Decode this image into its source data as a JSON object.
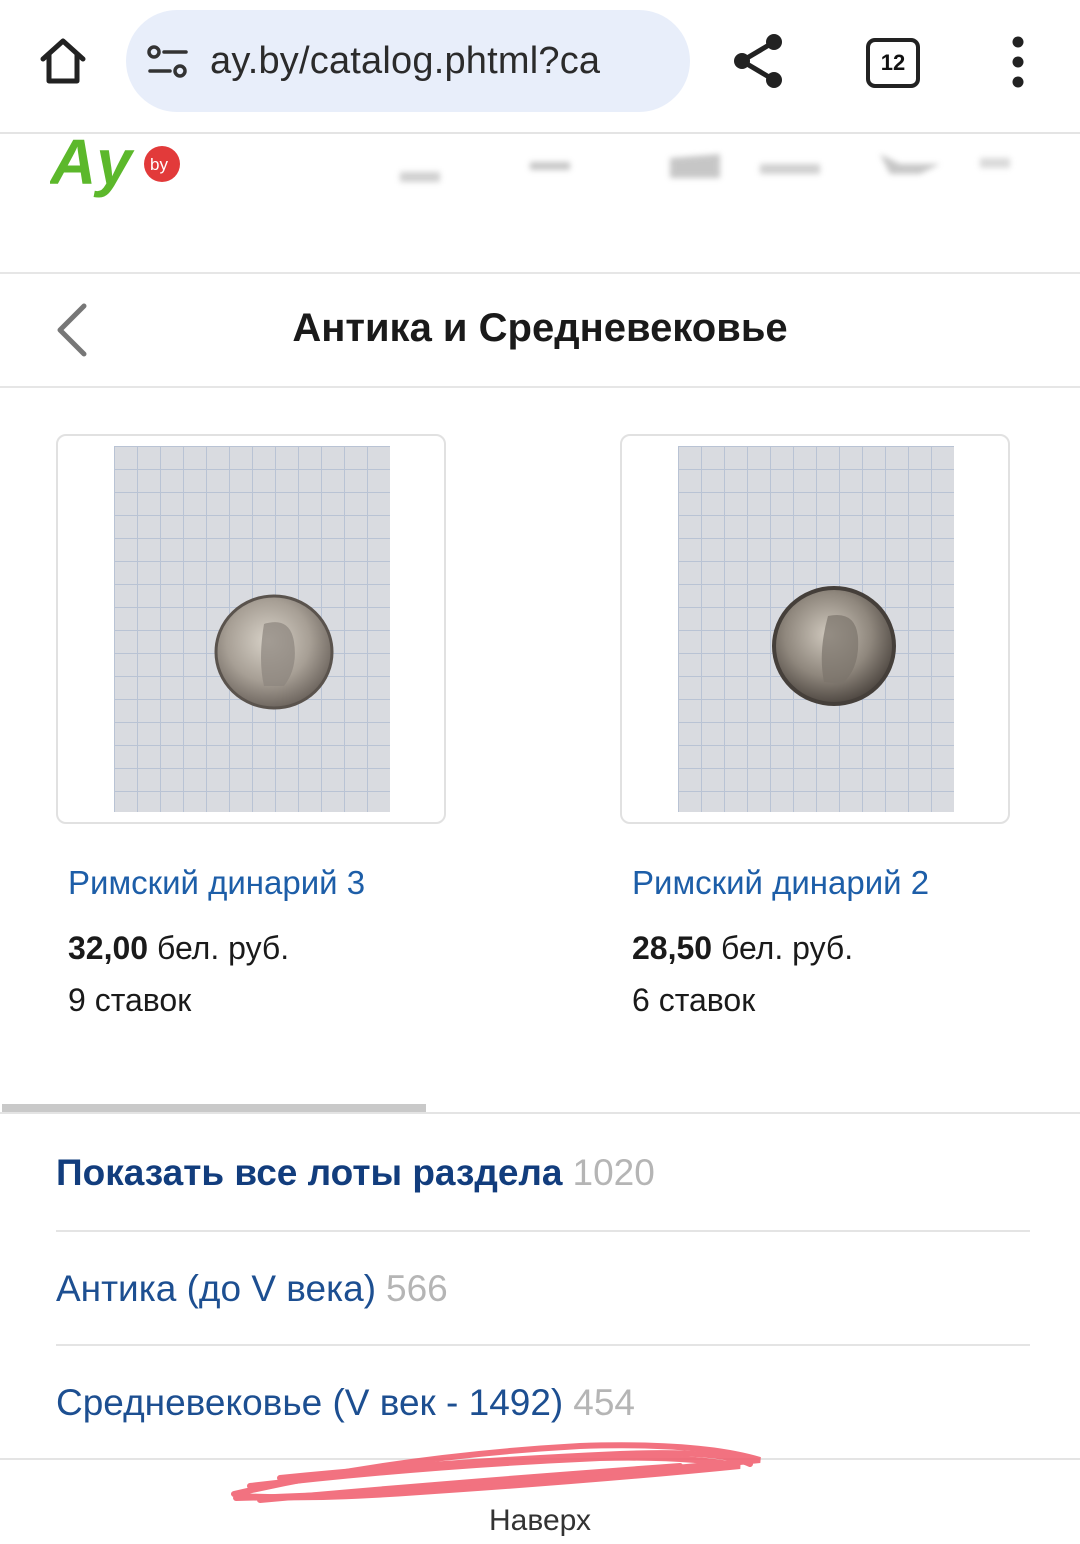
{
  "browser": {
    "url": "ay.by/catalog.phtml?ca",
    "tab_count": "12"
  },
  "site": {
    "logo_text": "Ay",
    "logo_badge": "by"
  },
  "page": {
    "title": "Антика и Средневековье"
  },
  "products": [
    {
      "name": "Римский динарий 3",
      "price_value": "32,00",
      "price_currency": "бел. руб.",
      "bids": "9 ставок"
    },
    {
      "name": "Римский динарий 2",
      "price_value": "28,50",
      "price_currency": "бел. руб.",
      "bids": "6 ставок"
    }
  ],
  "categories": [
    {
      "label": "Показать все лоты раздела",
      "count": "1020"
    },
    {
      "label": "Антика (до V века)",
      "count": "566"
    },
    {
      "label": "Средневековье (V век - 1492)",
      "count": "454"
    }
  ],
  "footer": {
    "to_top": "Наверх"
  },
  "colors": {
    "link_blue": "#1d5ea8",
    "logo_green": "#5cb82b",
    "logo_badge_red": "#e23a3a",
    "scribble_red": "#f05a6a"
  },
  "icons": [
    "home-icon",
    "site-info-icon",
    "share-icon",
    "tabs-icon",
    "more-vert-icon",
    "back-chevron-icon"
  ]
}
